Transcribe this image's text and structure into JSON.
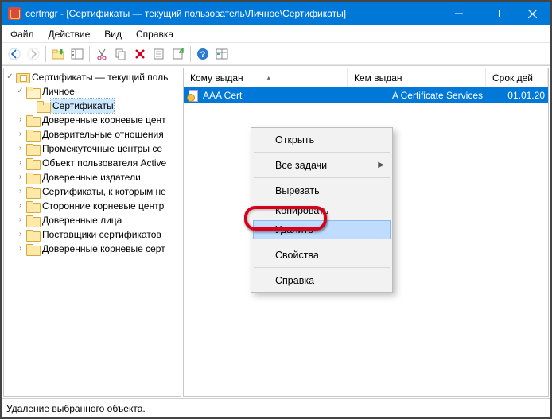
{
  "titlebar": {
    "app": "certmgr",
    "path": "[Сертификаты — текущий пользователь\\Личное\\Сертификаты]"
  },
  "menu": {
    "file": "Файл",
    "action": "Действие",
    "view": "Вид",
    "help": "Справка"
  },
  "tree": {
    "root": "Сертификаты — текущий поль",
    "personal": "Личное",
    "certs": "Сертификаты",
    "items": [
      "Доверенные корневые цент",
      "Доверительные отношения",
      "Промежуточные центры се",
      "Объект пользователя Active",
      "Доверенные издатели",
      "Сертификаты, к которым не",
      "Сторонние корневые центр",
      "Доверенные лица",
      "Поставщики сертификатов",
      "Доверенные корневые серт"
    ]
  },
  "columns": {
    "issued_to": "Кому выдан",
    "issued_by": "Кем выдан",
    "expires": "Срок дей"
  },
  "row": {
    "issued_to": "AAA Cert",
    "issued_by": "A Certificate Services",
    "expires": "01.01.20"
  },
  "context": {
    "open": "Открыть",
    "all_tasks": "Все задачи",
    "cut": "Вырезать",
    "copy": "Копировать",
    "delete": "Удалить",
    "properties": "Свойства",
    "help": "Справка"
  },
  "status": "Удаление выбранного объекта."
}
